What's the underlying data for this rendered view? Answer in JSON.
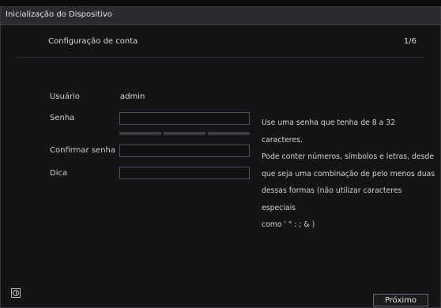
{
  "window": {
    "title": "Inicialização do Dispositivo"
  },
  "step": {
    "title": "Configuração de conta",
    "counter": "1/6"
  },
  "form": {
    "user_label": "Usuário",
    "user_value": "admin",
    "password_label": "Senha",
    "password_value": "",
    "confirm_label": "Confirmar senha",
    "confirm_value": "",
    "hint_label": "Dica",
    "hint_value": ""
  },
  "help": {
    "lines": [
      "Use uma senha que tenha de 8 a 32 caracteres.",
      "Pode conter números, símbolos e letras, desde",
      "que seja uma combinação de pelo menos duas",
      "dessas formas (não utilizar caracteres especiais",
      "como ' \" : ; & )"
    ]
  },
  "footer": {
    "next_label": "Próximo",
    "info_icon": "info-icon"
  },
  "colors": {
    "background": "#141416",
    "titlebar": "#2a2b2e",
    "border": "#505156",
    "strength_segment": "#3b3c40"
  }
}
